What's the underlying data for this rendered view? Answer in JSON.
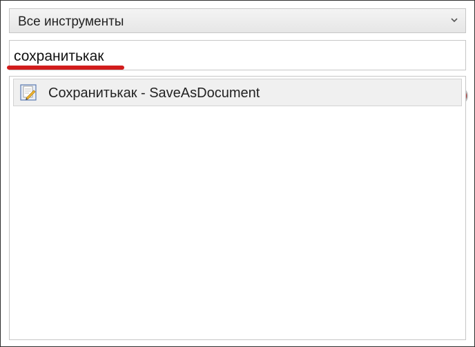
{
  "filter": {
    "selected": "Все инструменты",
    "arrow_icon": "chevron-down-icon"
  },
  "search": {
    "value": "сохранитькак",
    "clear_icon": "clear-circle-icon",
    "underline_color": "#d21c1c"
  },
  "results": [
    {
      "label": "Сохранитькак - SaveAsDocument",
      "icon": "save-as-document-icon"
    }
  ]
}
